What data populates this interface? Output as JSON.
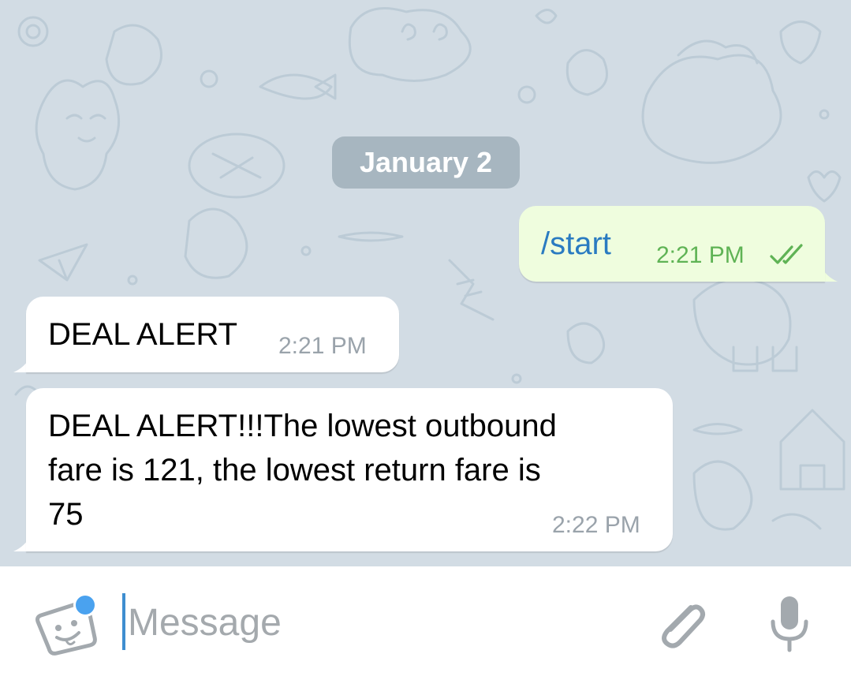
{
  "chat": {
    "date_label": "January 2",
    "messages": [
      {
        "direction": "outgoing",
        "text": "/start",
        "time": "2:21 PM",
        "status": "read"
      },
      {
        "direction": "incoming",
        "text": "DEAL ALERT",
        "time": "2:21 PM"
      },
      {
        "direction": "incoming",
        "lines": [
          "DEAL ALERT!!!The lowest outbound",
          "fare is 121, the lowest return fare is",
          "75"
        ],
        "time": "2:22 PM"
      }
    ]
  },
  "input": {
    "placeholder": "Message"
  },
  "icons": {
    "sticker": "sticker-icon",
    "attach": "paperclip-icon",
    "mic": "microphone-icon",
    "read_receipt": "double-check-icon"
  },
  "colors": {
    "chat_background": "#d2dce4",
    "outgoing_bubble": "#effdde",
    "incoming_bubble": "#ffffff",
    "command_link": "#2a7bc1",
    "outgoing_time": "#5fb355",
    "accent_blue": "#4aa2ef"
  }
}
